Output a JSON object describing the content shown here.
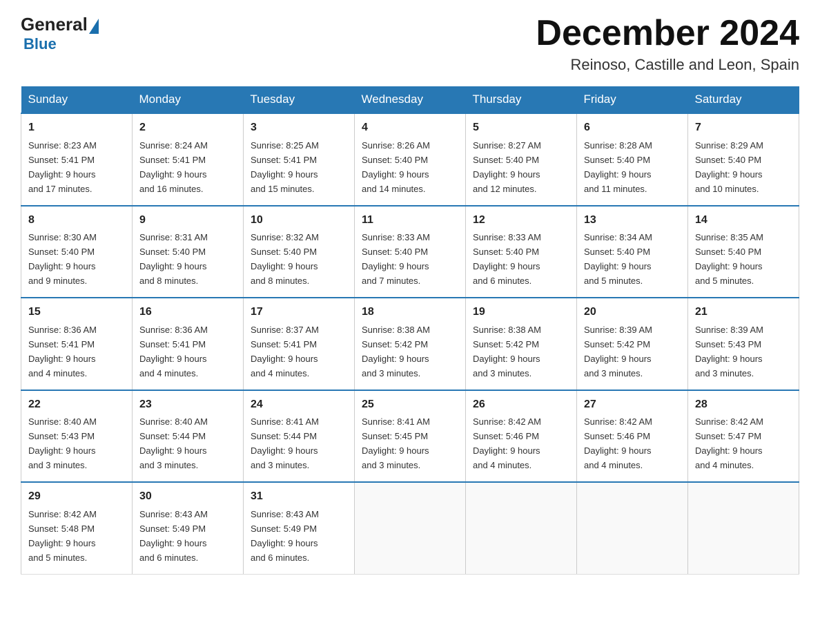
{
  "logo": {
    "general": "General",
    "blue": "Blue",
    "tagline": "Blue"
  },
  "header": {
    "month_year": "December 2024",
    "location": "Reinoso, Castille and Leon, Spain"
  },
  "weekdays": [
    "Sunday",
    "Monday",
    "Tuesday",
    "Wednesday",
    "Thursday",
    "Friday",
    "Saturday"
  ],
  "weeks": [
    [
      {
        "day": "1",
        "sunrise": "8:23 AM",
        "sunset": "5:41 PM",
        "daylight": "9 hours and 17 minutes."
      },
      {
        "day": "2",
        "sunrise": "8:24 AM",
        "sunset": "5:41 PM",
        "daylight": "9 hours and 16 minutes."
      },
      {
        "day": "3",
        "sunrise": "8:25 AM",
        "sunset": "5:41 PM",
        "daylight": "9 hours and 15 minutes."
      },
      {
        "day": "4",
        "sunrise": "8:26 AM",
        "sunset": "5:40 PM",
        "daylight": "9 hours and 14 minutes."
      },
      {
        "day": "5",
        "sunrise": "8:27 AM",
        "sunset": "5:40 PM",
        "daylight": "9 hours and 12 minutes."
      },
      {
        "day": "6",
        "sunrise": "8:28 AM",
        "sunset": "5:40 PM",
        "daylight": "9 hours and 11 minutes."
      },
      {
        "day": "7",
        "sunrise": "8:29 AM",
        "sunset": "5:40 PM",
        "daylight": "9 hours and 10 minutes."
      }
    ],
    [
      {
        "day": "8",
        "sunrise": "8:30 AM",
        "sunset": "5:40 PM",
        "daylight": "9 hours and 9 minutes."
      },
      {
        "day": "9",
        "sunrise": "8:31 AM",
        "sunset": "5:40 PM",
        "daylight": "9 hours and 8 minutes."
      },
      {
        "day": "10",
        "sunrise": "8:32 AM",
        "sunset": "5:40 PM",
        "daylight": "9 hours and 8 minutes."
      },
      {
        "day": "11",
        "sunrise": "8:33 AM",
        "sunset": "5:40 PM",
        "daylight": "9 hours and 7 minutes."
      },
      {
        "day": "12",
        "sunrise": "8:33 AM",
        "sunset": "5:40 PM",
        "daylight": "9 hours and 6 minutes."
      },
      {
        "day": "13",
        "sunrise": "8:34 AM",
        "sunset": "5:40 PM",
        "daylight": "9 hours and 5 minutes."
      },
      {
        "day": "14",
        "sunrise": "8:35 AM",
        "sunset": "5:40 PM",
        "daylight": "9 hours and 5 minutes."
      }
    ],
    [
      {
        "day": "15",
        "sunrise": "8:36 AM",
        "sunset": "5:41 PM",
        "daylight": "9 hours and 4 minutes."
      },
      {
        "day": "16",
        "sunrise": "8:36 AM",
        "sunset": "5:41 PM",
        "daylight": "9 hours and 4 minutes."
      },
      {
        "day": "17",
        "sunrise": "8:37 AM",
        "sunset": "5:41 PM",
        "daylight": "9 hours and 4 minutes."
      },
      {
        "day": "18",
        "sunrise": "8:38 AM",
        "sunset": "5:42 PM",
        "daylight": "9 hours and 3 minutes."
      },
      {
        "day": "19",
        "sunrise": "8:38 AM",
        "sunset": "5:42 PM",
        "daylight": "9 hours and 3 minutes."
      },
      {
        "day": "20",
        "sunrise": "8:39 AM",
        "sunset": "5:42 PM",
        "daylight": "9 hours and 3 minutes."
      },
      {
        "day": "21",
        "sunrise": "8:39 AM",
        "sunset": "5:43 PM",
        "daylight": "9 hours and 3 minutes."
      }
    ],
    [
      {
        "day": "22",
        "sunrise": "8:40 AM",
        "sunset": "5:43 PM",
        "daylight": "9 hours and 3 minutes."
      },
      {
        "day": "23",
        "sunrise": "8:40 AM",
        "sunset": "5:44 PM",
        "daylight": "9 hours and 3 minutes."
      },
      {
        "day": "24",
        "sunrise": "8:41 AM",
        "sunset": "5:44 PM",
        "daylight": "9 hours and 3 minutes."
      },
      {
        "day": "25",
        "sunrise": "8:41 AM",
        "sunset": "5:45 PM",
        "daylight": "9 hours and 3 minutes."
      },
      {
        "day": "26",
        "sunrise": "8:42 AM",
        "sunset": "5:46 PM",
        "daylight": "9 hours and 4 minutes."
      },
      {
        "day": "27",
        "sunrise": "8:42 AM",
        "sunset": "5:46 PM",
        "daylight": "9 hours and 4 minutes."
      },
      {
        "day": "28",
        "sunrise": "8:42 AM",
        "sunset": "5:47 PM",
        "daylight": "9 hours and 4 minutes."
      }
    ],
    [
      {
        "day": "29",
        "sunrise": "8:42 AM",
        "sunset": "5:48 PM",
        "daylight": "9 hours and 5 minutes."
      },
      {
        "day": "30",
        "sunrise": "8:43 AM",
        "sunset": "5:49 PM",
        "daylight": "9 hours and 6 minutes."
      },
      {
        "day": "31",
        "sunrise": "8:43 AM",
        "sunset": "5:49 PM",
        "daylight": "9 hours and 6 minutes."
      },
      null,
      null,
      null,
      null
    ]
  ],
  "labels": {
    "sunrise": "Sunrise:",
    "sunset": "Sunset:",
    "daylight": "Daylight:"
  }
}
